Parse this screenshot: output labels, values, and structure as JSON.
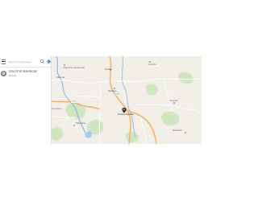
{
  "search": {
    "placeholder": "Search Google Maps"
  },
  "result": {
    "title": "ZOLOTYE RAYSKOE",
    "subtitle": "Russia"
  },
  "map_labels": [
    "Vostochnye Orodnikovsky",
    "Kamenka",
    "Borskoe",
    "Ivanovka",
    "Rayskoye",
    "Zolotye Rayskoe",
    "Pokrovskoe",
    "Sosnovka",
    "Makarovka",
    "Kuznetsovo"
  ],
  "road_shields": [
    "A-123",
    "P-45"
  ],
  "colors": {
    "map_bg": "#f1efe8",
    "park": "#cfe6c0",
    "water": "#a8c9ee",
    "river": "#8fb8e6",
    "main_road": "#f2b266",
    "road": "#ffffff",
    "marker": "#202124"
  },
  "icons": [
    "menu-icon",
    "search-icon",
    "directions-icon",
    "place-icon",
    "pin-icon",
    "map-dot-icon"
  ]
}
